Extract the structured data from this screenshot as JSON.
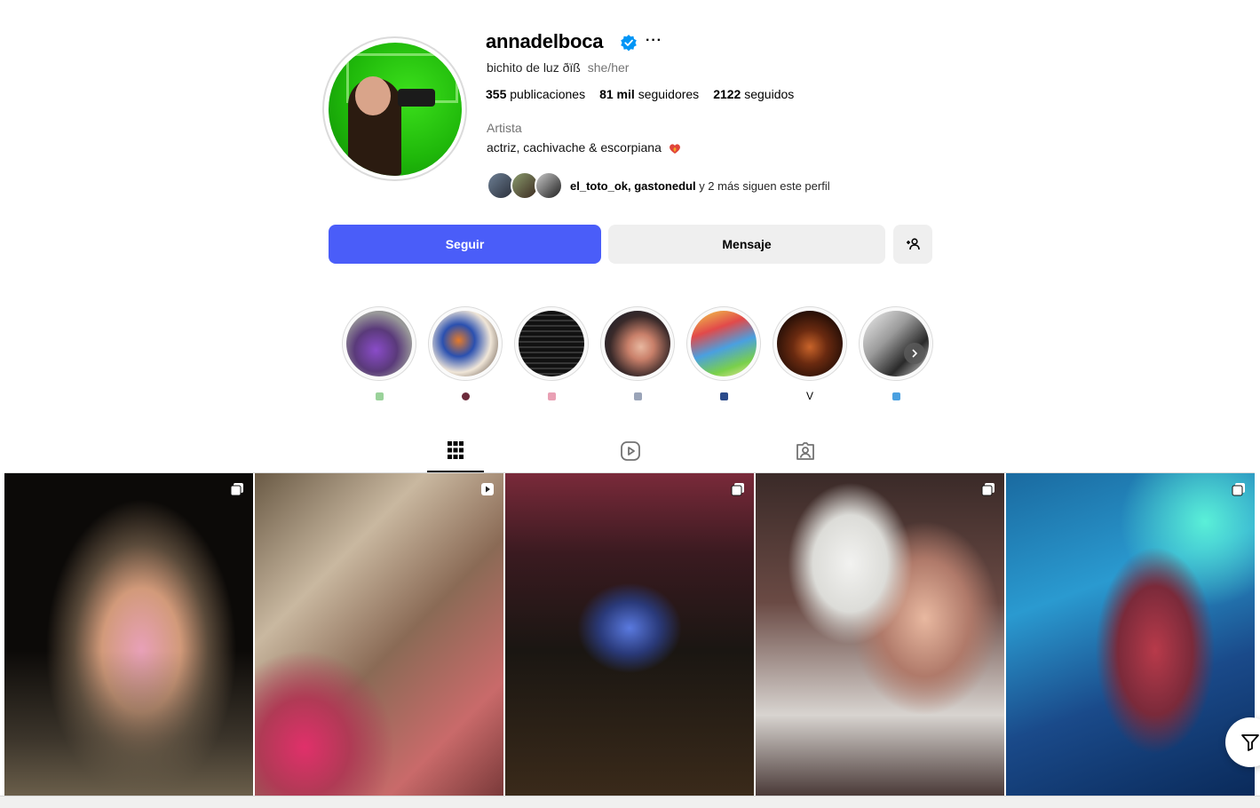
{
  "profile": {
    "username": "annadelboca",
    "subtitle": "bichito de luz ðïß",
    "pronouns": "she/her",
    "posts_count": "355",
    "posts_label": "publicaciones",
    "followers_count": "81 mil",
    "followers_label": "seguidores",
    "following_count": "2122",
    "following_label": "seguidos",
    "category": "Artista",
    "bio": "actriz, cachivache & escorpiana",
    "followed_by_users": "el_toto_ok, gastonedul",
    "followed_by_rest": " y 2 más siguen este perfil"
  },
  "actions": {
    "follow_label": "Seguir",
    "message_label": "Mensaje"
  },
  "highlights": [
    {
      "label": "",
      "emoji_color": "#9ad29a"
    },
    {
      "label": "",
      "emoji_color": "#6b2a3a"
    },
    {
      "label": "",
      "emoji_color": "#e9a0b4"
    },
    {
      "label": "",
      "emoji_color": "#9aa4b8"
    },
    {
      "label": "",
      "emoji_color": "#2a4a8a"
    },
    {
      "label": "V",
      "emoji_color": ""
    },
    {
      "label": "",
      "emoji_color": "#4aa0e0"
    }
  ],
  "tabs": [
    "posts-grid",
    "reels",
    "tagged"
  ],
  "colors": {
    "follow_button": "#4a5df9",
    "verified": "#0095f6",
    "secondary_button": "#efefef"
  },
  "icons": [
    "verified-badge-icon",
    "more-options-icon",
    "add-person-icon",
    "chevron-right-icon",
    "grid-icon",
    "reels-icon",
    "tagged-icon",
    "carousel-icon",
    "clip-icon",
    "filter-icon"
  ]
}
